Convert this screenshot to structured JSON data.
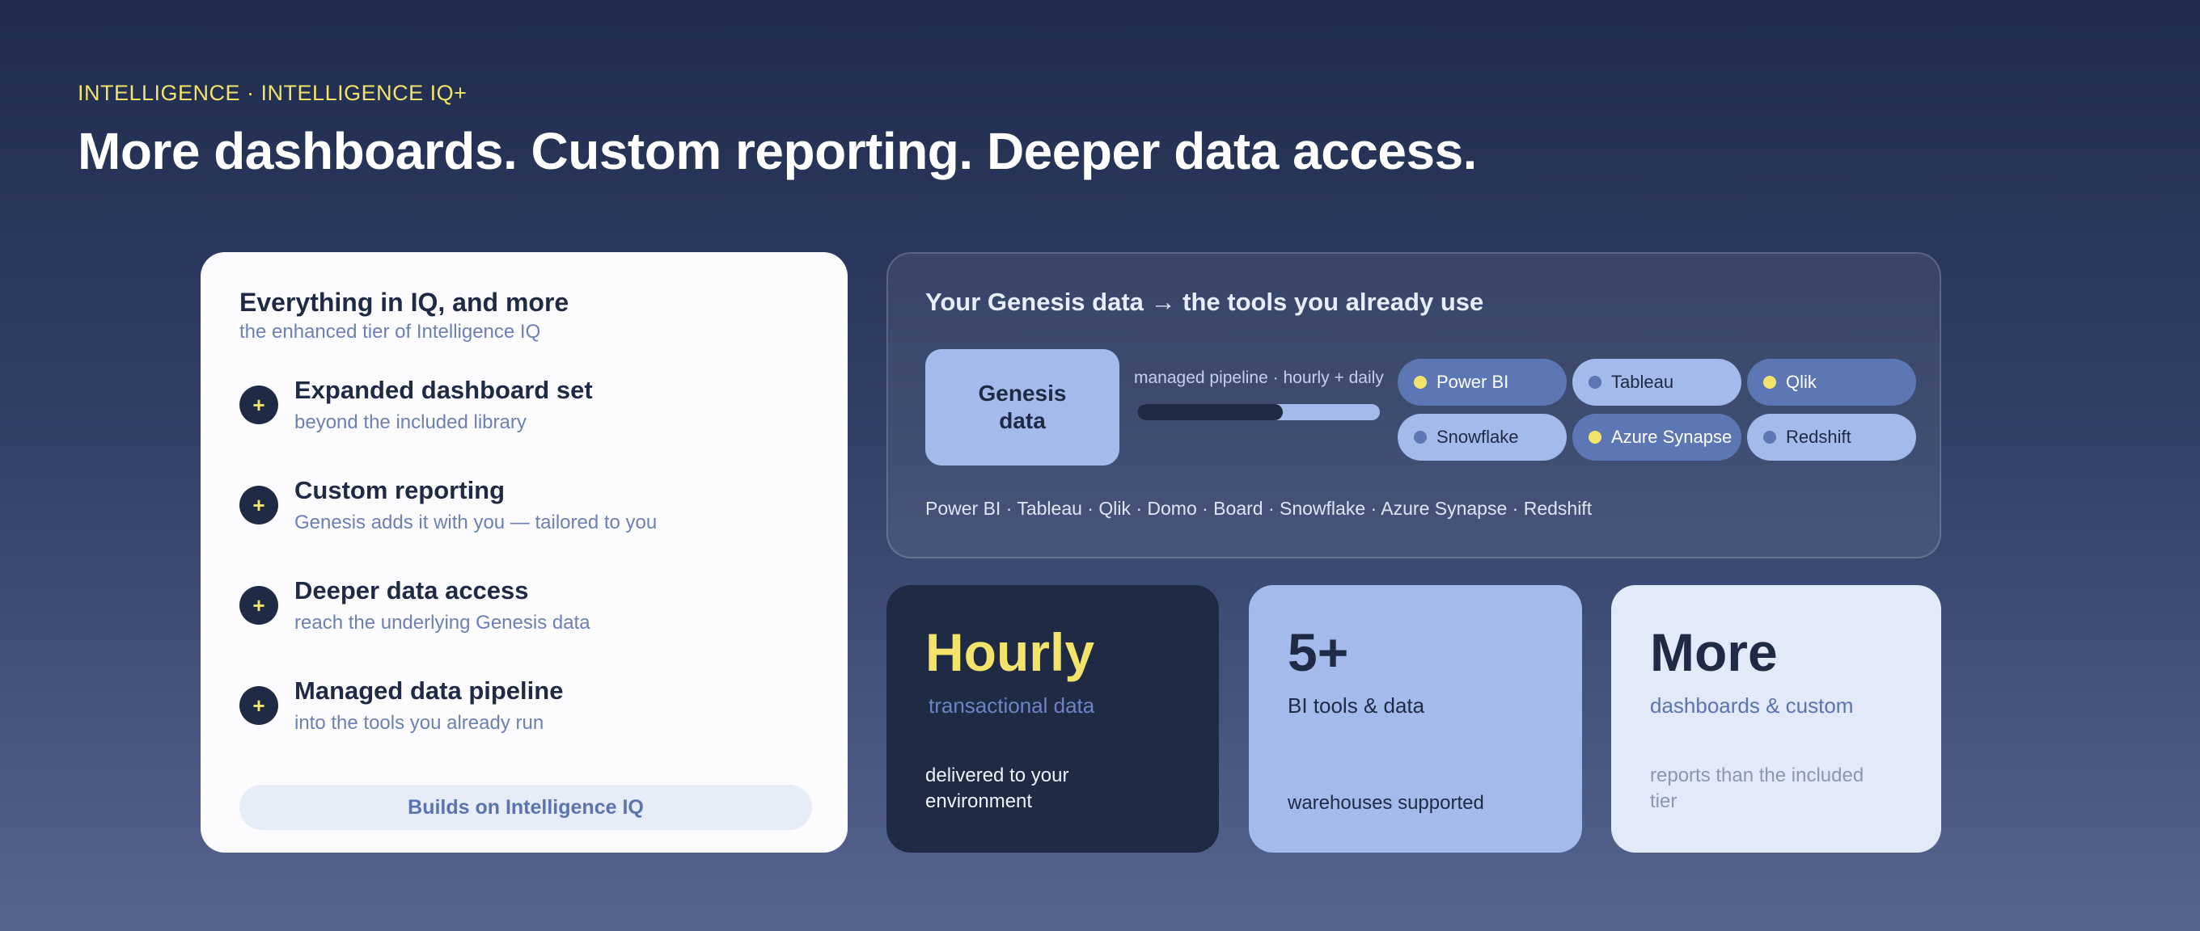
{
  "header": {
    "eyebrow": "INTELLIGENCE · INTELLIGENCE IQ+",
    "headline": "More dashboards. Custom reporting. Deeper data access."
  },
  "left_card": {
    "title": "Everything in IQ, and more",
    "subtitle": "the enhanced tier of Intelligence IQ",
    "plus_icon": "+",
    "features": [
      {
        "title": "Expanded dashboard set",
        "subtitle": "beyond the included library"
      },
      {
        "title": "Custom reporting",
        "subtitle": "Genesis adds it with you — tailored to you"
      },
      {
        "title": "Deeper data access",
        "subtitle": "reach the underlying Genesis data"
      },
      {
        "title": "Managed data pipeline",
        "subtitle": "into the tools you already run"
      }
    ],
    "footer_pill": "Builds on Intelligence IQ"
  },
  "tools_card": {
    "title": "Your Genesis data → the tools you already use",
    "source_line1": "Genesis",
    "source_line2": "data",
    "pipeline_label": "managed pipeline · hourly + daily",
    "pipeline_progress": 0.6,
    "chips": [
      {
        "label": "Power BI",
        "style": "dark",
        "dot": "yellow"
      },
      {
        "label": "Tableau",
        "style": "light",
        "dot": "blue"
      },
      {
        "label": "Qlik",
        "style": "dark",
        "dot": "yellow"
      },
      {
        "label": "Snowflake",
        "style": "light",
        "dot": "blue"
      },
      {
        "label": "Azure Synapse",
        "style": "dark",
        "dot": "yellow"
      },
      {
        "label": "Redshift",
        "style": "light",
        "dot": "blue"
      }
    ],
    "tools_list": "Power BI · Tableau · Qlik · Domo · Board · Snowflake · Azure Synapse · Redshift"
  },
  "stats": [
    {
      "big": "Hourly",
      "sub": "transactional data",
      "foot": "delivered to your environment"
    },
    {
      "big": "5+",
      "sub": "BI tools & data",
      "foot": "warehouses supported"
    },
    {
      "big": "More",
      "sub": "dashboards & custom",
      "foot": "reports than the included tier"
    }
  ],
  "colors": {
    "accent_yellow": "#f2e36a",
    "navy": "#1f2a45",
    "periwinkle": "#a4baeb",
    "mid_blue": "#5c77b3"
  }
}
